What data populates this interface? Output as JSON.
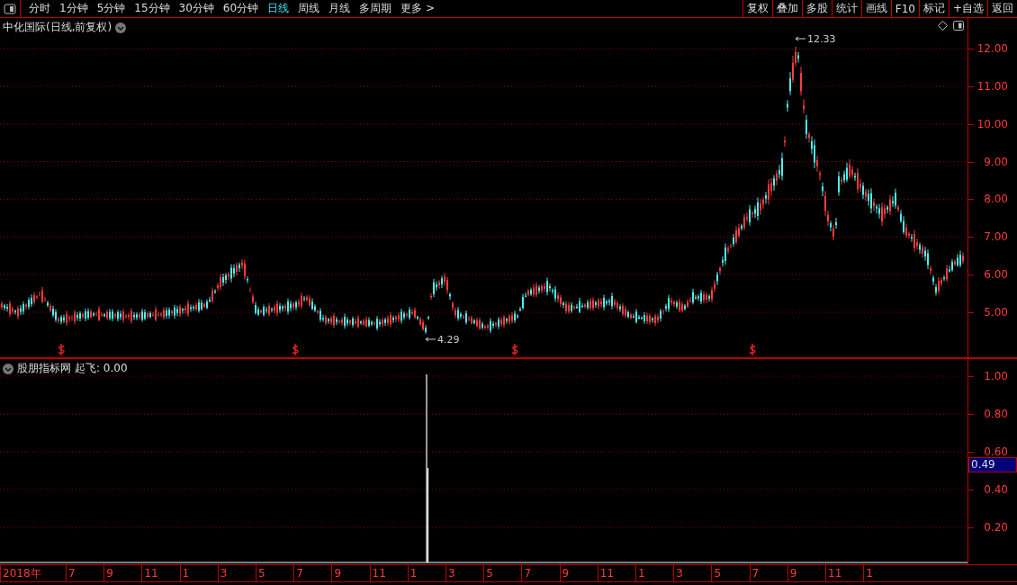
{
  "toolbar": {
    "tabs": [
      {
        "label": "分时",
        "selected": false
      },
      {
        "label": "1分钟",
        "selected": false
      },
      {
        "label": "5分钟",
        "selected": false
      },
      {
        "label": "15分钟",
        "selected": false
      },
      {
        "label": "30分钟",
        "selected": false
      },
      {
        "label": "60分钟",
        "selected": false
      },
      {
        "label": "日线",
        "selected": true
      },
      {
        "label": "周线",
        "selected": false
      },
      {
        "label": "月线",
        "selected": false
      },
      {
        "label": "多周期",
        "selected": false
      },
      {
        "label": "更多 >",
        "selected": false
      }
    ],
    "buttons": [
      "复权",
      "叠加",
      "多股",
      "统计",
      "画线",
      "F10",
      "标记",
      "+自选",
      "返回"
    ]
  },
  "main_chart": {
    "title": "中化国际(日线,前复权)",
    "price_labels": [
      "12.00",
      "11.00",
      "10.00",
      "9.00",
      "8.00",
      "7.00",
      "6.00",
      "5.00"
    ],
    "high_label": "12.33",
    "low_label": "4.29"
  },
  "indicator": {
    "name": "股朋指标网",
    "value_label": "起飞: 0.00",
    "axis_labels": [
      "1.00",
      "0.80",
      "0.60",
      "0.40",
      "0.20"
    ],
    "cursor_value": "0.49"
  },
  "date_axis": {
    "labels": [
      "2018年",
      "7",
      "9",
      "11",
      "1",
      "3",
      "5",
      "7",
      "9",
      "11",
      "1",
      "3",
      "5",
      "7",
      "9",
      "11",
      "1",
      "3",
      "5",
      "7",
      "9",
      "11",
      "1"
    ]
  }
}
